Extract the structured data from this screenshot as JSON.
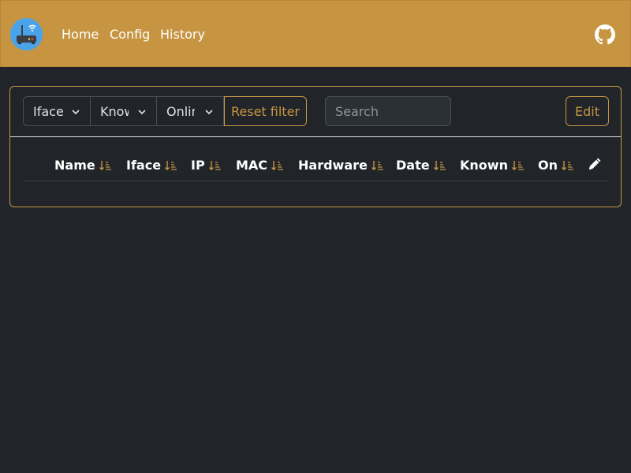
{
  "nav": {
    "logo_icon": "router-wifi-icon",
    "links": [
      "Home",
      "Config",
      "History"
    ],
    "github_icon": "github-icon",
    "bg_color": "#c79542"
  },
  "filters": {
    "iface": "Iface",
    "known": "Known",
    "online": "Online",
    "reset_label": "Reset filter",
    "search_placeholder": "Search",
    "edit_label": "Edit"
  },
  "table": {
    "columns": [
      "Name",
      "Iface",
      "IP",
      "MAC",
      "Hardware",
      "Date",
      "Known",
      "On"
    ],
    "sort_icon": "sort-down-icon",
    "edit_icon": "pencil-icon",
    "rows": []
  },
  "colors": {
    "accent": "#c79542",
    "background": "#212529",
    "text": "#dee2e6"
  }
}
